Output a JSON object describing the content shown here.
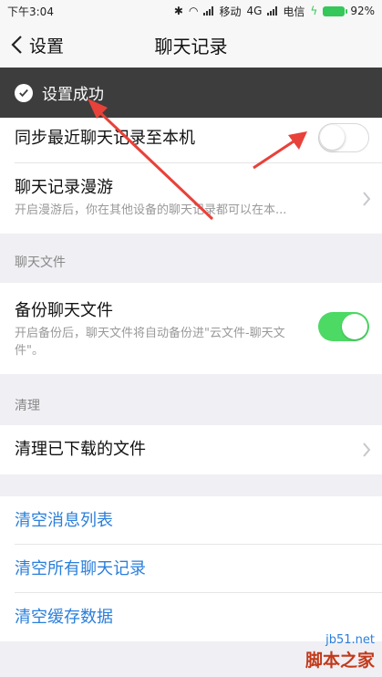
{
  "status_bar": {
    "time": "下午3:04",
    "carrier1": "移动",
    "network": "4G",
    "carrier2": "电信",
    "battery": "92%"
  },
  "nav": {
    "back_label": "设置",
    "title": "聊天记录"
  },
  "toast": {
    "text": "设置成功"
  },
  "rows": {
    "sync": {
      "label": "同步最近聊天记录至本机",
      "toggle": false
    },
    "roaming": {
      "label": "聊天记录漫游",
      "desc": "开启漫游后，你在其他设备的聊天记录都可以在本..."
    }
  },
  "sections": {
    "files": "聊天文件",
    "cleanup": "清理"
  },
  "backup": {
    "label": "备份聊天文件",
    "desc": "开启备份后，聊天文件将自动备份进\"云文件-聊天文件\"。",
    "toggle": true
  },
  "cleanup_row": {
    "label": "清理已下载的文件"
  },
  "actions": {
    "clear_list": "清空消息列表",
    "clear_all": "清空所有聊天记录",
    "clear_cache": "清空缓存数据"
  },
  "watermark": {
    "site": "jb51.net",
    "name": "脚本之家"
  },
  "colors": {
    "link": "#2a7fdb",
    "toggle_on": "#4cd964",
    "toast_bg": "#3d3d3d",
    "arrow": "#e8413a"
  }
}
